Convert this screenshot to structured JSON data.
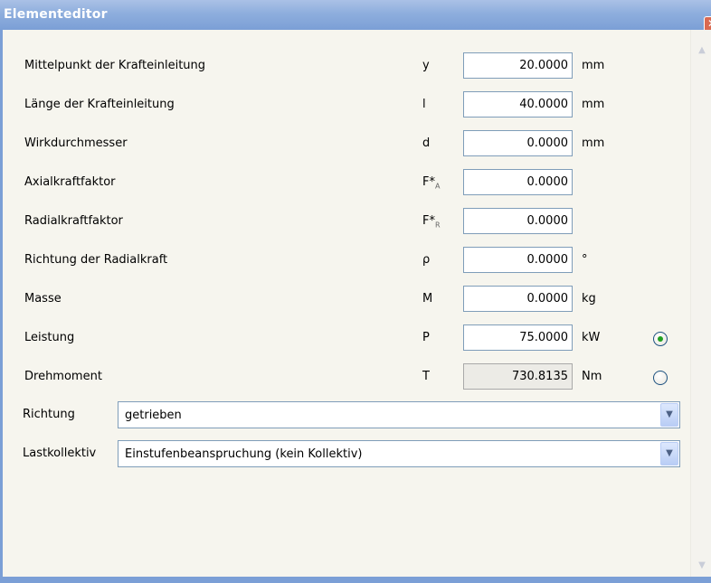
{
  "window": {
    "title": "Elementeditor",
    "close_glyph": "✕"
  },
  "scrollbar": {
    "up_glyph": "▲",
    "down_glyph": "▼"
  },
  "fields": [
    {
      "label": "Mittelpunkt der Krafteinleitung",
      "symbol": "y",
      "sub": "",
      "value": "20.0000",
      "unit": "mm"
    },
    {
      "label": "Länge der Krafteinleitung",
      "symbol": "l",
      "sub": "",
      "value": "40.0000",
      "unit": "mm"
    },
    {
      "label": "Wirkdurchmesser",
      "symbol": "d",
      "sub": "",
      "value": "0.0000",
      "unit": "mm"
    },
    {
      "label": "Axialkraftfaktor",
      "symbol": "F*",
      "sub": "A",
      "value": "0.0000",
      "unit": ""
    },
    {
      "label": "Radialkraftfaktor",
      "symbol": "F*",
      "sub": "R",
      "value": "0.0000",
      "unit": ""
    },
    {
      "label": "Richtung der Radialkraft",
      "symbol": "ρ",
      "sub": "",
      "value": "0.0000",
      "unit": "°"
    },
    {
      "label": "Masse",
      "symbol": "M",
      "sub": "",
      "value": "0.0000",
      "unit": "kg"
    },
    {
      "label": "Leistung",
      "symbol": "P",
      "sub": "",
      "value": "75.0000",
      "unit": "kW",
      "radio_selected": true
    },
    {
      "label": "Drehmoment",
      "symbol": "T",
      "sub": "",
      "value": "730.8135",
      "unit": "Nm",
      "radio_selected": false
    }
  ],
  "combos": [
    {
      "label": "Richtung",
      "value": "getrieben",
      "arrow": "▼"
    },
    {
      "label": "Lastkollektiv",
      "value": "Einstufenbeanspruchung (kein Kollektiv)",
      "arrow": "▼"
    }
  ]
}
